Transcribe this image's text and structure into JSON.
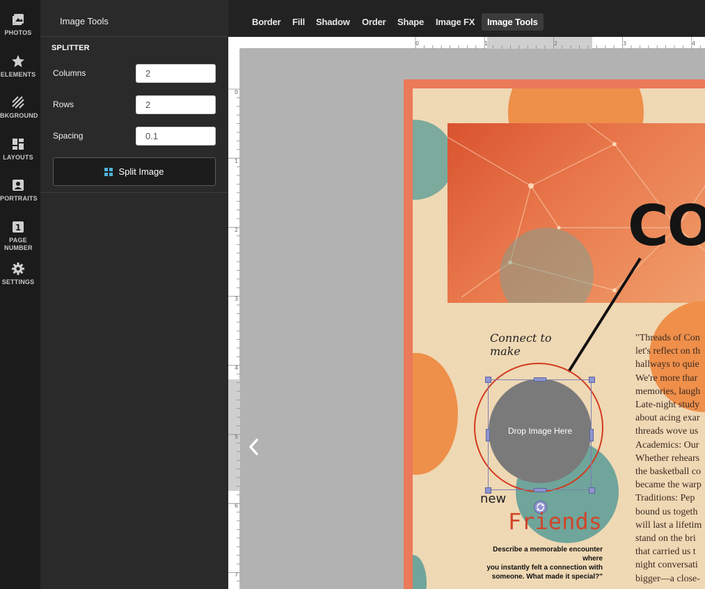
{
  "rail": {
    "items": [
      {
        "label": "PHOTOS",
        "icon": "photos-icon"
      },
      {
        "label": "ELEMENTS",
        "icon": "star-icon"
      },
      {
        "label": "BKGROUND",
        "icon": "background-icon"
      },
      {
        "label": "LAYOUTS",
        "icon": "layouts-icon"
      },
      {
        "label": "PORTRAITS",
        "icon": "portrait-icon"
      },
      {
        "label": "PAGE NUMBER",
        "icon": "page-number-icon"
      },
      {
        "label": "SETTINGS",
        "icon": "gear-icon"
      }
    ]
  },
  "panel": {
    "title": "Image Tools",
    "section": "SPLITTER",
    "columns_label": "Columns",
    "columns_value": "2",
    "rows_label": "Rows",
    "rows_value": "2",
    "spacing_label": "Spacing",
    "spacing_value": "0.1",
    "split_button": "Split Image"
  },
  "toolbar": {
    "tabs": [
      "Border",
      "Fill",
      "Shadow",
      "Order",
      "Shape",
      "Image FX",
      "Image Tools"
    ],
    "active_tab": "Image Tools"
  },
  "rulers": {
    "top": [
      "0",
      "1",
      "2",
      "3",
      "4"
    ],
    "left": [
      "0",
      "1",
      "2",
      "3",
      "4",
      "5",
      "6",
      "7"
    ]
  },
  "page": {
    "hero_title": "CO",
    "connect_text_1": "Connect to",
    "connect_text_2": "make",
    "new_text": "new",
    "friends_text": "Friends",
    "caption_lines": [
      "Describe a memorable encounter where",
      "you instantly felt a connection with",
      "someone. What made it special?\""
    ],
    "drop_zone_text": "Drop Image Here",
    "body_lines": [
      "\"Threads of Con",
      "let's reflect on th",
      "hallways to quie",
      "We're more thar",
      "memories, laugh",
      "Late-night study",
      "about acing exar",
      "threads wove us",
      "Academics: Our",
      "Whether rehears",
      "the basketball co",
      "became the warp",
      "Traditions: Pep",
      "bound us togeth",
      "will last a lifetim",
      "stand on the bri",
      "that carried us t",
      "night conversati",
      "bigger—a close-"
    ]
  },
  "colors": {
    "accent_orange": "#ea7a5a",
    "friends_red": "#d1452a",
    "selection_blue": "#8f95cf",
    "teal_circle": "#6fa59a",
    "orange_circle": "#ee8f4a"
  }
}
